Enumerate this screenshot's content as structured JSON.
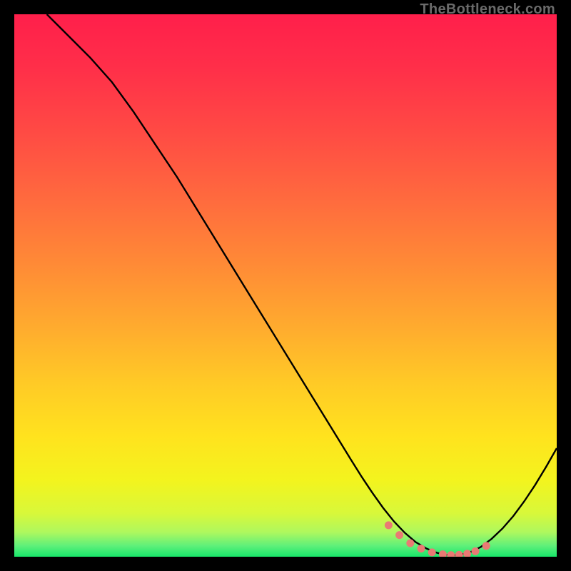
{
  "watermark": "TheBottleneck.com",
  "chart_data": {
    "type": "line",
    "title": "",
    "xlabel": "",
    "ylabel": "",
    "xlim": [
      0,
      100
    ],
    "ylim": [
      0,
      100
    ],
    "grid": false,
    "legend": false,
    "series": [
      {
        "name": "curve",
        "x": [
          6,
          10,
          14,
          18,
          22,
          26,
          30,
          34,
          38,
          42,
          46,
          50,
          54,
          58,
          62,
          64,
          66,
          68,
          70,
          72,
          74,
          76,
          78,
          80,
          82,
          84,
          86,
          88,
          90,
          92,
          94,
          96,
          98,
          100
        ],
        "y": [
          100,
          96,
          92,
          87.5,
          82,
          76,
          70,
          63.5,
          57,
          50.5,
          44,
          37.5,
          31,
          24.5,
          18,
          14.8,
          11.8,
          9,
          6.5,
          4.4,
          2.7,
          1.5,
          0.7,
          0.3,
          0.3,
          0.8,
          1.8,
          3.3,
          5.2,
          7.5,
          10.2,
          13.2,
          16.5,
          20
        ]
      },
      {
        "name": "dots",
        "x": [
          69,
          71,
          73,
          75,
          77,
          79,
          80.5,
          82,
          83.5,
          85,
          87
        ],
        "y": [
          5.8,
          4.0,
          2.5,
          1.5,
          0.8,
          0.45,
          0.3,
          0.35,
          0.55,
          1.0,
          2.0
        ]
      }
    ],
    "gradient_stops": [
      {
        "offset": 0.0,
        "color": "#ff1f4b"
      },
      {
        "offset": 0.1,
        "color": "#ff2f49"
      },
      {
        "offset": 0.22,
        "color": "#ff4b44"
      },
      {
        "offset": 0.34,
        "color": "#ff6a3e"
      },
      {
        "offset": 0.46,
        "color": "#ff8a36"
      },
      {
        "offset": 0.58,
        "color": "#ffac2e"
      },
      {
        "offset": 0.68,
        "color": "#ffca26"
      },
      {
        "offset": 0.78,
        "color": "#ffe31e"
      },
      {
        "offset": 0.86,
        "color": "#f3f41e"
      },
      {
        "offset": 0.92,
        "color": "#d8f83a"
      },
      {
        "offset": 0.955,
        "color": "#aef85e"
      },
      {
        "offset": 0.98,
        "color": "#5ef07a"
      },
      {
        "offset": 1.0,
        "color": "#18e66a"
      }
    ],
    "dot_color": "#e97a74",
    "curve_color": "#000000"
  }
}
